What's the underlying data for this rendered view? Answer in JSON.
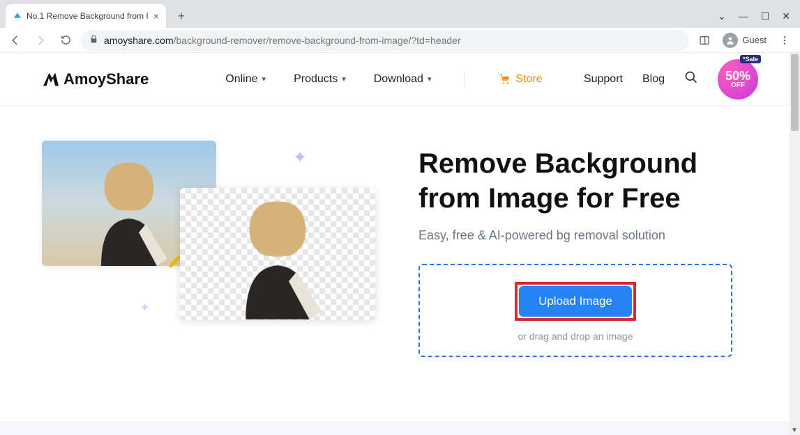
{
  "browser": {
    "tab_title": "No.1 Remove Background from I",
    "url_host": "amoyshare.com",
    "url_path": "/background-remover/remove-background-from-image/?td=header",
    "guest_label": "Guest"
  },
  "header": {
    "brand": "AmoyShare",
    "nav": {
      "online": "Online",
      "products": "Products",
      "download": "Download",
      "store": "Store",
      "support": "Support",
      "blog": "Blog"
    },
    "sale": {
      "tag": "*Sale",
      "percent": "50%",
      "off": "OFF"
    }
  },
  "hero": {
    "title_line1": "Remove Background",
    "title_line2": "from Image for Free",
    "subtitle": "Easy, free & AI-powered bg removal solution",
    "upload_label": "Upload Image",
    "drop_hint": "or drag and drop an image"
  },
  "colors": {
    "accent_blue": "#2683f5",
    "store_orange": "#f08a00",
    "highlight_red": "#da2a2a",
    "sale_pink": "#e349cc"
  }
}
